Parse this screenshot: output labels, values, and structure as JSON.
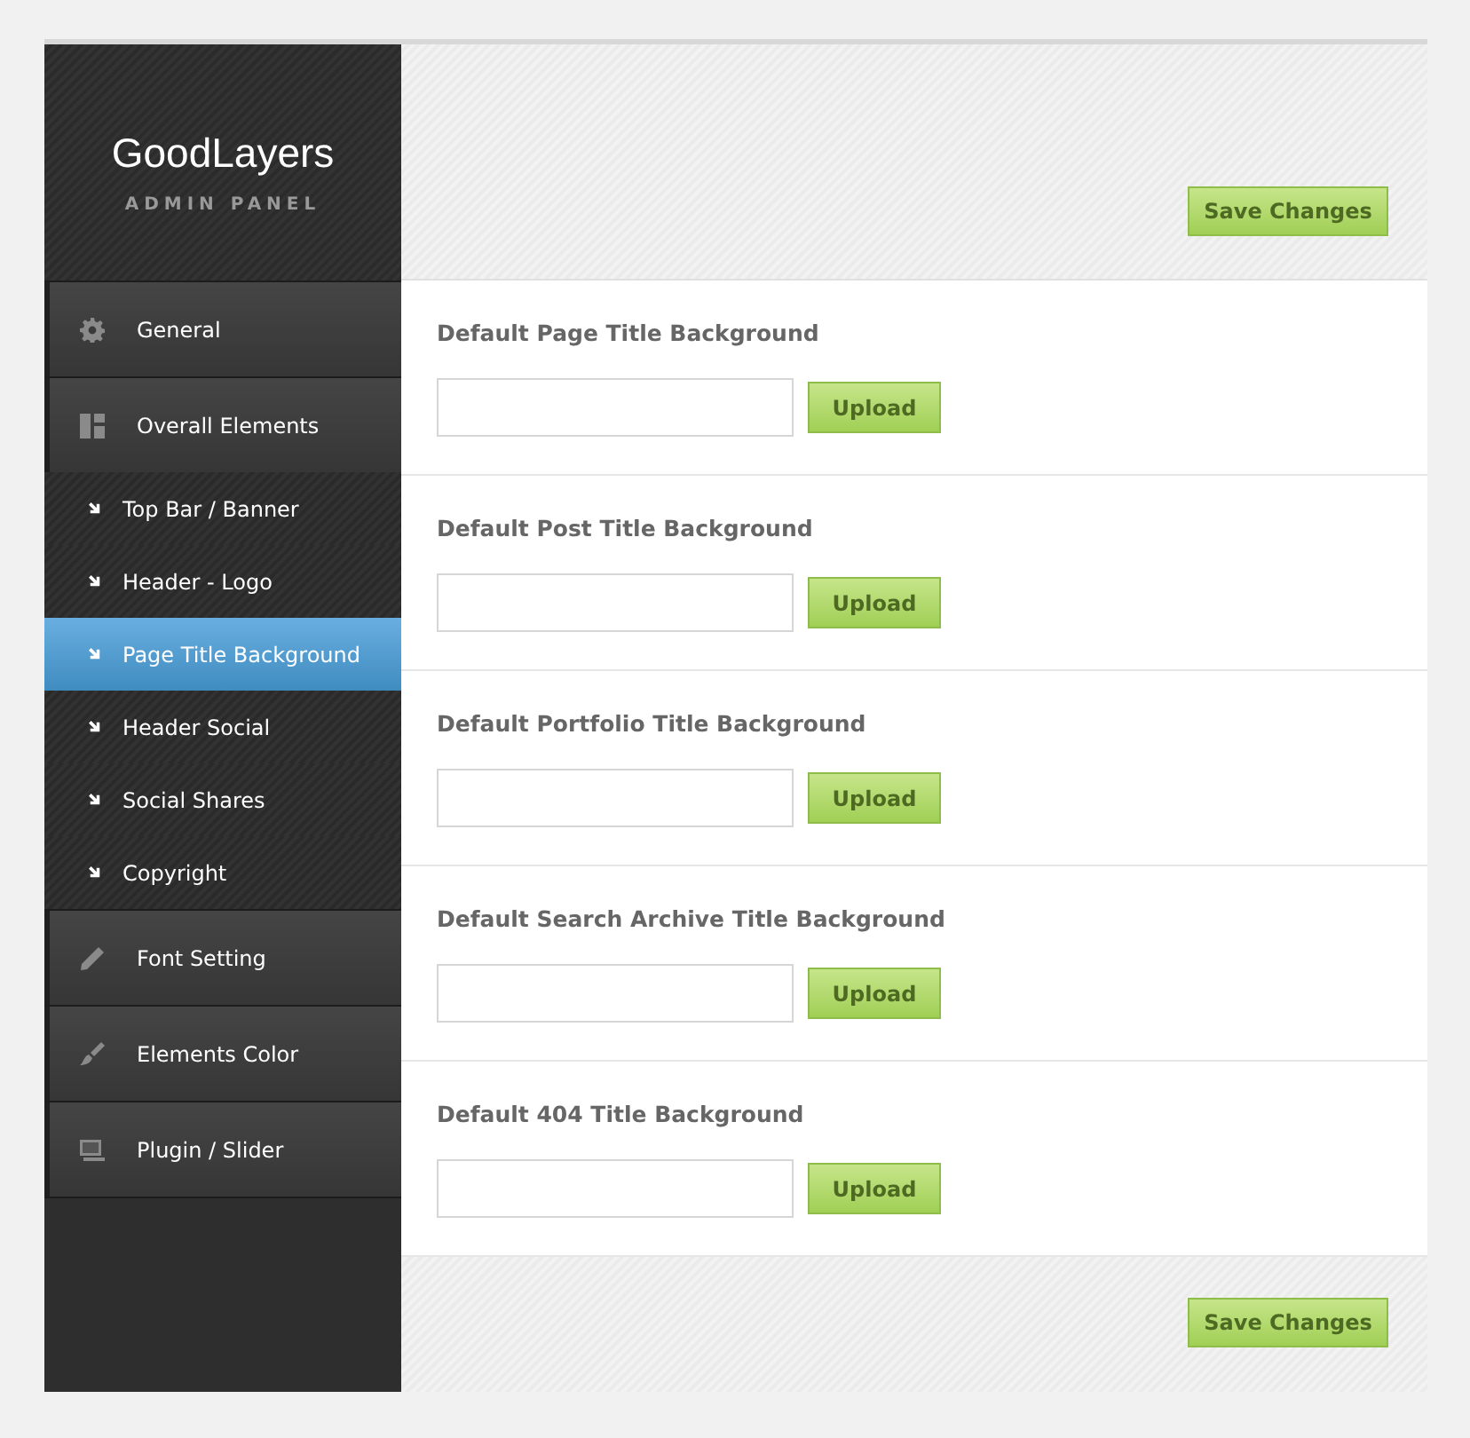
{
  "brand": {
    "title": "GoodLayers",
    "subtitle": "ADMIN PANEL"
  },
  "sidebar": {
    "items": [
      {
        "kind": "main",
        "label": "General",
        "selected": false
      },
      {
        "kind": "main",
        "label": "Overall Elements",
        "selected": false
      },
      {
        "kind": "sub",
        "label": "Top Bar / Banner",
        "selected": false
      },
      {
        "kind": "sub",
        "label": "Header - Logo",
        "selected": false
      },
      {
        "kind": "sub",
        "label": "Page Title Background",
        "selected": true
      },
      {
        "kind": "sub",
        "label": "Header Social",
        "selected": false
      },
      {
        "kind": "sub",
        "label": "Social Shares",
        "selected": false
      },
      {
        "kind": "sub",
        "label": "Copyright",
        "selected": false
      },
      {
        "kind": "main",
        "label": "Font Setting",
        "selected": false
      },
      {
        "kind": "main",
        "label": "Elements Color",
        "selected": false
      },
      {
        "kind": "main",
        "label": "Plugin / Slider",
        "selected": false
      }
    ]
  },
  "top_button": "Save Changes",
  "fields": [
    {
      "label": "Default Page Title Background",
      "button": "Upload"
    },
    {
      "label": "Default Post Title Background",
      "button": "Upload"
    },
    {
      "label": "Default Portfolio Title Background",
      "button": "Upload"
    },
    {
      "label": "Default Search Archive Title Background",
      "button": "Upload"
    },
    {
      "label": "Default 404 Title Background",
      "button": "Upload"
    }
  ],
  "bottom_button": "Save Changes"
}
